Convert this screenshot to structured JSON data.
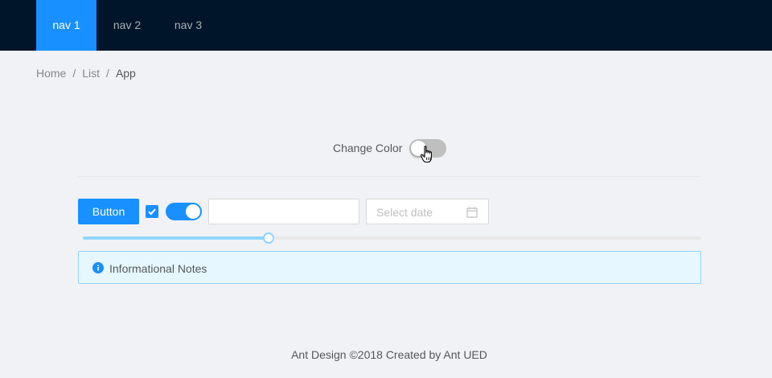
{
  "header": {
    "nav": [
      {
        "label": "nav 1",
        "active": true
      },
      {
        "label": "nav 2",
        "active": false
      },
      {
        "label": "nav 3",
        "active": false
      }
    ]
  },
  "breadcrumb": {
    "items": [
      "Home",
      "List",
      "App"
    ],
    "separator": "/"
  },
  "color_switch": {
    "label": "Change Color",
    "checked": false
  },
  "controls": {
    "button_label": "Button",
    "checkbox_checked": true,
    "toggle_checked": true,
    "text_input_value": "",
    "date_placeholder": "Select date",
    "slider_value_fraction": 0.3
  },
  "alert": {
    "type": "info",
    "message": "Informational Notes"
  },
  "footer": {
    "text": "Ant Design ©2018 Created by Ant UED"
  },
  "colors": {
    "header_bg": "#001529",
    "primary": "#1890ff",
    "page_bg": "#f0f2f5",
    "alert_bg": "#e6f7ff",
    "alert_border": "#91d5ff"
  },
  "icons": [
    "check-icon",
    "calendar-icon",
    "info-circle-icon",
    "hand-pointer-icon"
  ]
}
